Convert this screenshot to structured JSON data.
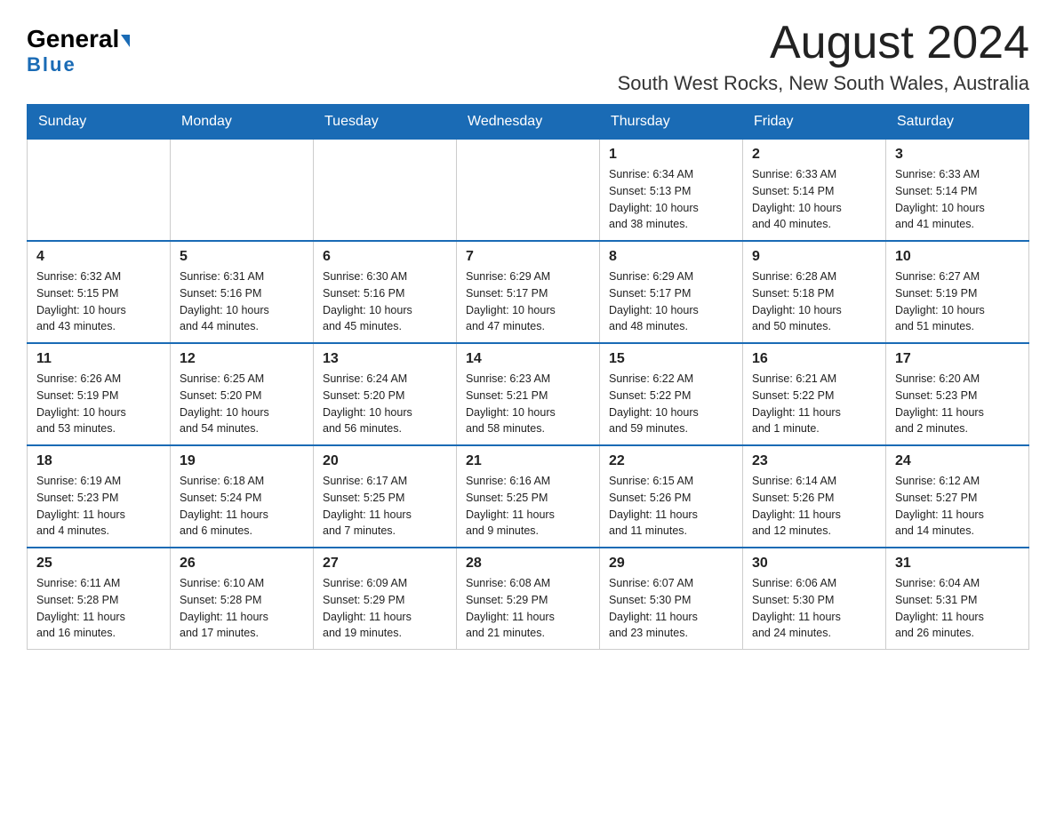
{
  "logo": {
    "general": "General",
    "blue": "Blue"
  },
  "header": {
    "month_year": "August 2024",
    "location": "South West Rocks, New South Wales, Australia"
  },
  "days_of_week": [
    "Sunday",
    "Monday",
    "Tuesday",
    "Wednesday",
    "Thursday",
    "Friday",
    "Saturday"
  ],
  "weeks": [
    [
      {
        "day": "",
        "info": ""
      },
      {
        "day": "",
        "info": ""
      },
      {
        "day": "",
        "info": ""
      },
      {
        "day": "",
        "info": ""
      },
      {
        "day": "1",
        "info": "Sunrise: 6:34 AM\nSunset: 5:13 PM\nDaylight: 10 hours\nand 38 minutes."
      },
      {
        "day": "2",
        "info": "Sunrise: 6:33 AM\nSunset: 5:14 PM\nDaylight: 10 hours\nand 40 minutes."
      },
      {
        "day": "3",
        "info": "Sunrise: 6:33 AM\nSunset: 5:14 PM\nDaylight: 10 hours\nand 41 minutes."
      }
    ],
    [
      {
        "day": "4",
        "info": "Sunrise: 6:32 AM\nSunset: 5:15 PM\nDaylight: 10 hours\nand 43 minutes."
      },
      {
        "day": "5",
        "info": "Sunrise: 6:31 AM\nSunset: 5:16 PM\nDaylight: 10 hours\nand 44 minutes."
      },
      {
        "day": "6",
        "info": "Sunrise: 6:30 AM\nSunset: 5:16 PM\nDaylight: 10 hours\nand 45 minutes."
      },
      {
        "day": "7",
        "info": "Sunrise: 6:29 AM\nSunset: 5:17 PM\nDaylight: 10 hours\nand 47 minutes."
      },
      {
        "day": "8",
        "info": "Sunrise: 6:29 AM\nSunset: 5:17 PM\nDaylight: 10 hours\nand 48 minutes."
      },
      {
        "day": "9",
        "info": "Sunrise: 6:28 AM\nSunset: 5:18 PM\nDaylight: 10 hours\nand 50 minutes."
      },
      {
        "day": "10",
        "info": "Sunrise: 6:27 AM\nSunset: 5:19 PM\nDaylight: 10 hours\nand 51 minutes."
      }
    ],
    [
      {
        "day": "11",
        "info": "Sunrise: 6:26 AM\nSunset: 5:19 PM\nDaylight: 10 hours\nand 53 minutes."
      },
      {
        "day": "12",
        "info": "Sunrise: 6:25 AM\nSunset: 5:20 PM\nDaylight: 10 hours\nand 54 minutes."
      },
      {
        "day": "13",
        "info": "Sunrise: 6:24 AM\nSunset: 5:20 PM\nDaylight: 10 hours\nand 56 minutes."
      },
      {
        "day": "14",
        "info": "Sunrise: 6:23 AM\nSunset: 5:21 PM\nDaylight: 10 hours\nand 58 minutes."
      },
      {
        "day": "15",
        "info": "Sunrise: 6:22 AM\nSunset: 5:22 PM\nDaylight: 10 hours\nand 59 minutes."
      },
      {
        "day": "16",
        "info": "Sunrise: 6:21 AM\nSunset: 5:22 PM\nDaylight: 11 hours\nand 1 minute."
      },
      {
        "day": "17",
        "info": "Sunrise: 6:20 AM\nSunset: 5:23 PM\nDaylight: 11 hours\nand 2 minutes."
      }
    ],
    [
      {
        "day": "18",
        "info": "Sunrise: 6:19 AM\nSunset: 5:23 PM\nDaylight: 11 hours\nand 4 minutes."
      },
      {
        "day": "19",
        "info": "Sunrise: 6:18 AM\nSunset: 5:24 PM\nDaylight: 11 hours\nand 6 minutes."
      },
      {
        "day": "20",
        "info": "Sunrise: 6:17 AM\nSunset: 5:25 PM\nDaylight: 11 hours\nand 7 minutes."
      },
      {
        "day": "21",
        "info": "Sunrise: 6:16 AM\nSunset: 5:25 PM\nDaylight: 11 hours\nand 9 minutes."
      },
      {
        "day": "22",
        "info": "Sunrise: 6:15 AM\nSunset: 5:26 PM\nDaylight: 11 hours\nand 11 minutes."
      },
      {
        "day": "23",
        "info": "Sunrise: 6:14 AM\nSunset: 5:26 PM\nDaylight: 11 hours\nand 12 minutes."
      },
      {
        "day": "24",
        "info": "Sunrise: 6:12 AM\nSunset: 5:27 PM\nDaylight: 11 hours\nand 14 minutes."
      }
    ],
    [
      {
        "day": "25",
        "info": "Sunrise: 6:11 AM\nSunset: 5:28 PM\nDaylight: 11 hours\nand 16 minutes."
      },
      {
        "day": "26",
        "info": "Sunrise: 6:10 AM\nSunset: 5:28 PM\nDaylight: 11 hours\nand 17 minutes."
      },
      {
        "day": "27",
        "info": "Sunrise: 6:09 AM\nSunset: 5:29 PM\nDaylight: 11 hours\nand 19 minutes."
      },
      {
        "day": "28",
        "info": "Sunrise: 6:08 AM\nSunset: 5:29 PM\nDaylight: 11 hours\nand 21 minutes."
      },
      {
        "day": "29",
        "info": "Sunrise: 6:07 AM\nSunset: 5:30 PM\nDaylight: 11 hours\nand 23 minutes."
      },
      {
        "day": "30",
        "info": "Sunrise: 6:06 AM\nSunset: 5:30 PM\nDaylight: 11 hours\nand 24 minutes."
      },
      {
        "day": "31",
        "info": "Sunrise: 6:04 AM\nSunset: 5:31 PM\nDaylight: 11 hours\nand 26 minutes."
      }
    ]
  ]
}
